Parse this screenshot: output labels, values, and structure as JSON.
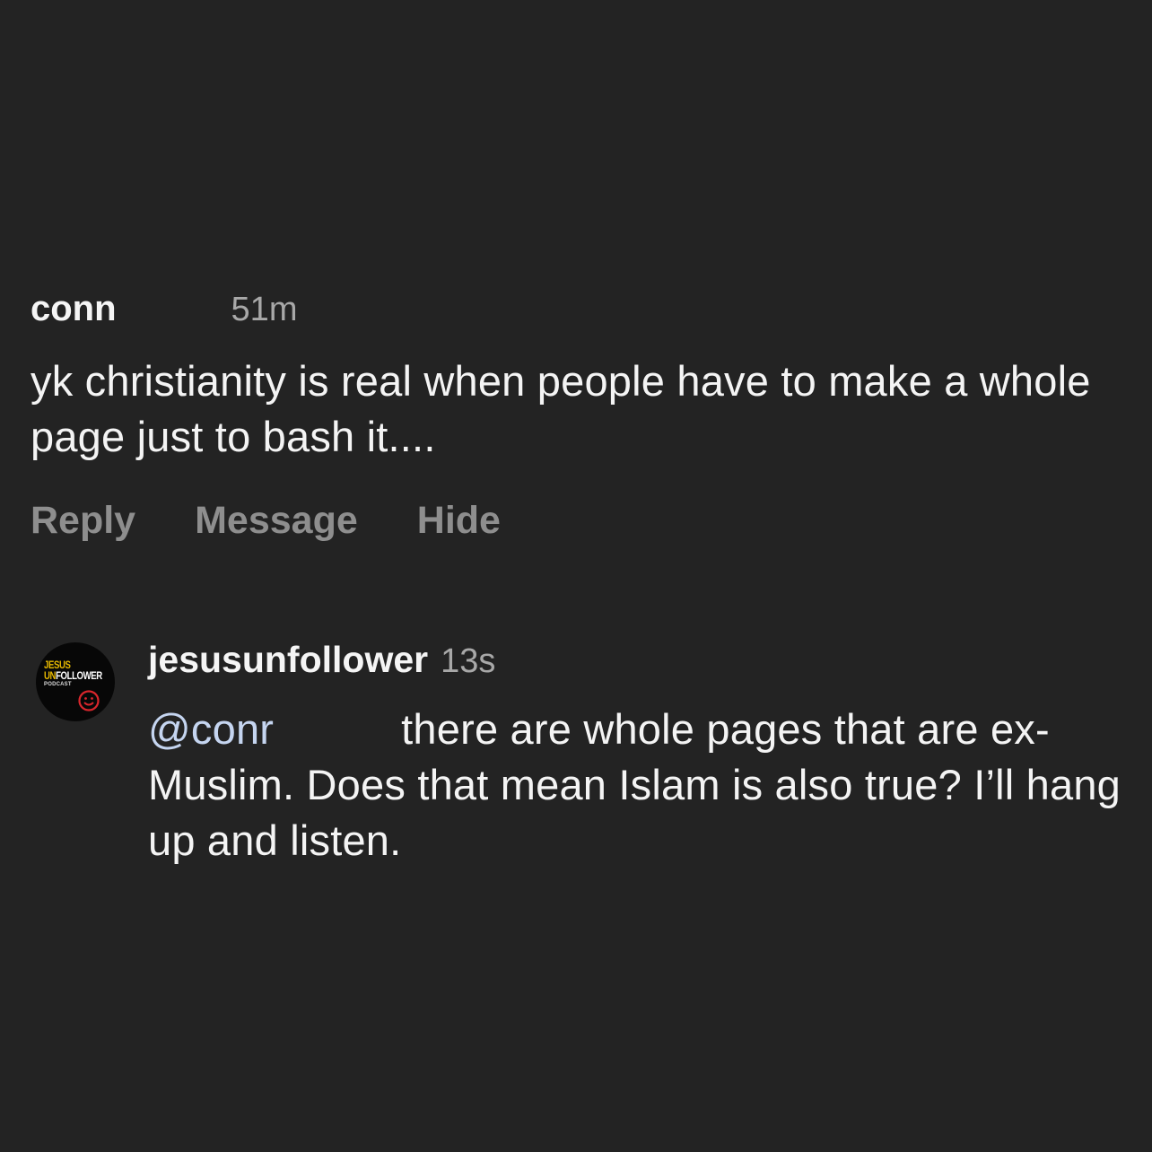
{
  "comment1": {
    "username": "conn",
    "timestamp": "51m",
    "text": "yk christianity is real when people have to make a whole page just to bash it....",
    "actions": {
      "reply": "Reply",
      "message": "Message",
      "hide": "Hide"
    }
  },
  "comment2": {
    "avatar": {
      "line1": "JESUS",
      "line2_prefix": "UN",
      "line2_rest": "FOLLOWER",
      "line3": "PODCAST",
      "colors": {
        "yellow": "#e6b800",
        "red": "#d9262c"
      }
    },
    "username": "jesusunfollower",
    "timestamp": "13s",
    "mention": "@conr",
    "text": "there are whole pages that are ex-Muslim. Does that mean Islam is also true? I’ll hang up and listen."
  },
  "colors": {
    "background": "#232323",
    "mention": "#c5d5f0",
    "muted": "#8e8e8e"
  }
}
